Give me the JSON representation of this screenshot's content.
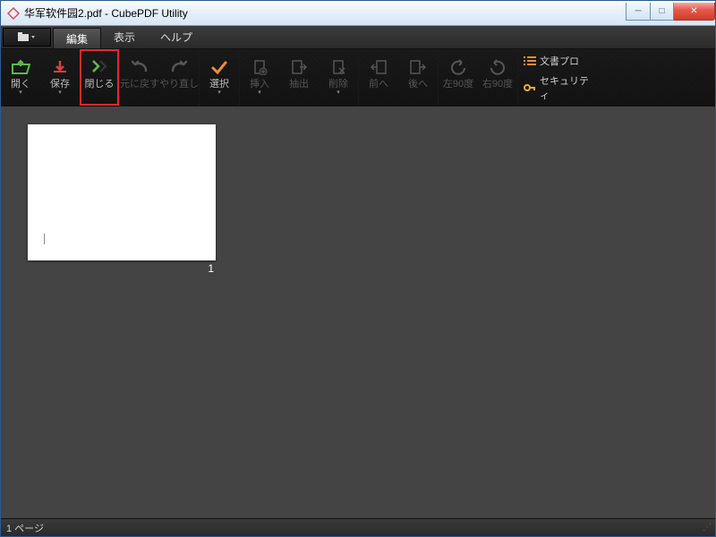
{
  "window": {
    "title": "华军软件园2.pdf - CubePDF Utility",
    "buttons": {
      "min": "─",
      "max": "□",
      "close": "✕"
    }
  },
  "menubar": {
    "folder": "■▾",
    "tabs": [
      {
        "label": "編集",
        "active": true
      },
      {
        "label": "表示",
        "active": false
      },
      {
        "label": "ヘルプ",
        "active": false
      }
    ]
  },
  "ribbon": {
    "groups": [
      [
        {
          "name": "open",
          "label": "開く",
          "dropdown": true,
          "iconColor": "#5fb84d"
        },
        {
          "name": "save",
          "label": "保存",
          "dropdown": true,
          "iconColor": "#d84040"
        },
        {
          "name": "close",
          "label": "閉じる",
          "dropdown": false,
          "iconColor": "#5fb84d",
          "highlight": true
        }
      ],
      [
        {
          "name": "undo",
          "label": "元に戻す",
          "disabled": true
        },
        {
          "name": "redo",
          "label": "やり直し",
          "disabled": true
        }
      ],
      [
        {
          "name": "select",
          "label": "選択",
          "dropdown": true,
          "iconColor": "#e89030"
        }
      ],
      [
        {
          "name": "insert",
          "label": "挿入",
          "dropdown": true,
          "disabled": true
        },
        {
          "name": "extract",
          "label": "抽出",
          "dropdown": false,
          "disabled": true
        },
        {
          "name": "delete",
          "label": "削除",
          "dropdown": true,
          "disabled": true
        }
      ],
      [
        {
          "name": "prev",
          "label": "前へ",
          "disabled": true
        },
        {
          "name": "next",
          "label": "後へ",
          "disabled": true
        }
      ],
      [
        {
          "name": "rotate-left",
          "label": "左90度",
          "disabled": true
        },
        {
          "name": "rotate-right",
          "label": "右90度",
          "disabled": true
        }
      ]
    ],
    "side": [
      {
        "name": "doc-props",
        "label": "文書プロ",
        "icon": "list",
        "color": "#e89030"
      },
      {
        "name": "security",
        "label": "セキュリティ",
        "icon": "key",
        "color": "#e8b030"
      }
    ]
  },
  "content": {
    "page_number": "1"
  },
  "statusbar": {
    "text": "1 ページ"
  }
}
